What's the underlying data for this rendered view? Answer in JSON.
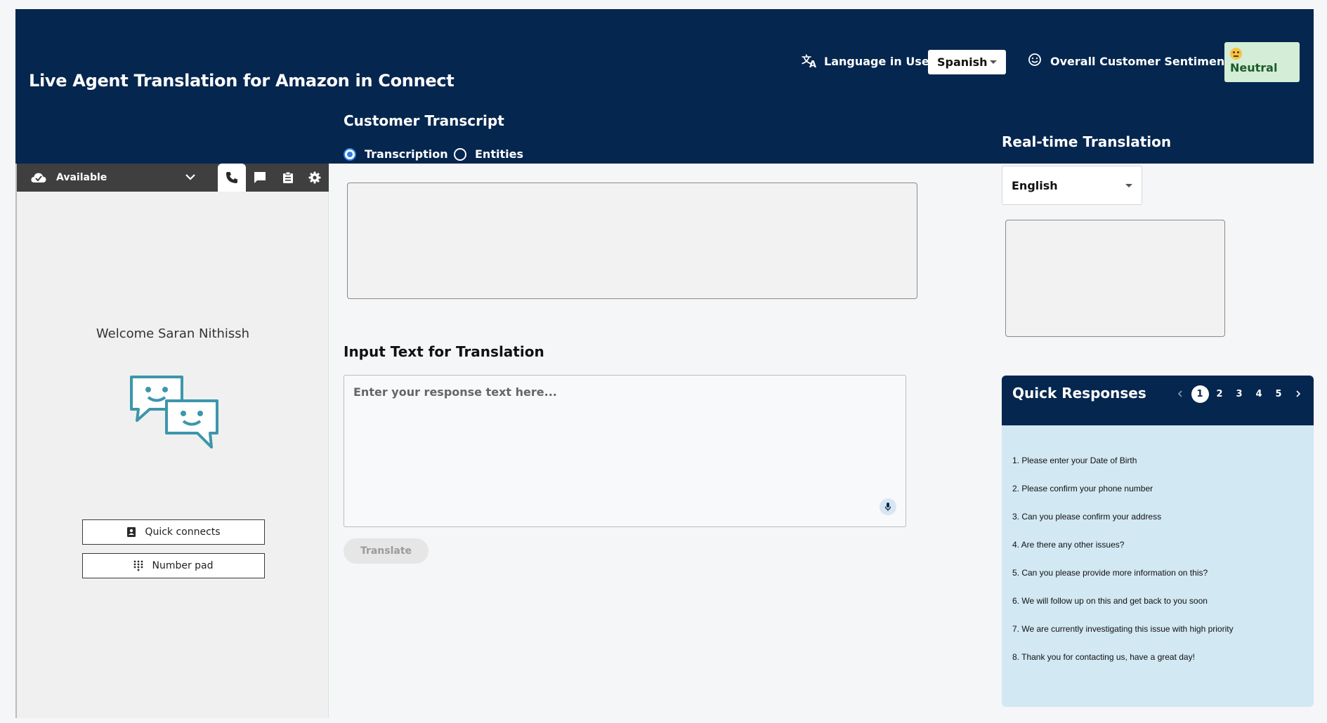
{
  "header": {
    "title": "Live Agent Translation for Amazon in Connect",
    "language_label": "Language in Use:",
    "language_value": "Spanish",
    "sentiment_label": "Overall Customer Sentiment:",
    "sentiment_value": "Neutral",
    "customer_transcript_title": "Customer Transcript",
    "transcript_modes": [
      "Transcription",
      "Entities"
    ],
    "realtime_title": "Real-time Translation"
  },
  "ccp": {
    "status": "Available",
    "welcome": "Welcome Saran Nithissh",
    "quick_connects": "Quick connects",
    "number_pad": "Number pad"
  },
  "center": {
    "input_title": "Input Text for Translation",
    "input_placeholder": "Enter your response text here...",
    "translate_label": "Translate"
  },
  "right": {
    "target_language": "English",
    "quick_responses_title": "Quick Responses",
    "pages": [
      "1",
      "2",
      "3",
      "4",
      "5"
    ],
    "current_page": "1",
    "responses": [
      "1. Please enter your Date of Birth",
      "2. Please confirm your phone number",
      "3. Can you please confirm your address",
      "4. Are there any other issues?",
      "5. Can you please provide more information on this?",
      "6. We will follow up on this and get back to you soon",
      "7. We are currently investigating this issue with high priority",
      "8. Thank you for contacting us, have a great day!"
    ]
  },
  "colors": {
    "header_bg": "#05264e",
    "quick_responses_bg": "#d2e8f3",
    "sentiment_neutral_bg": "#d3edd6",
    "radio_accent": "#2f7fe0",
    "ccp_bar": "#3f3f3f",
    "bot_icon": "#3d96ac"
  }
}
